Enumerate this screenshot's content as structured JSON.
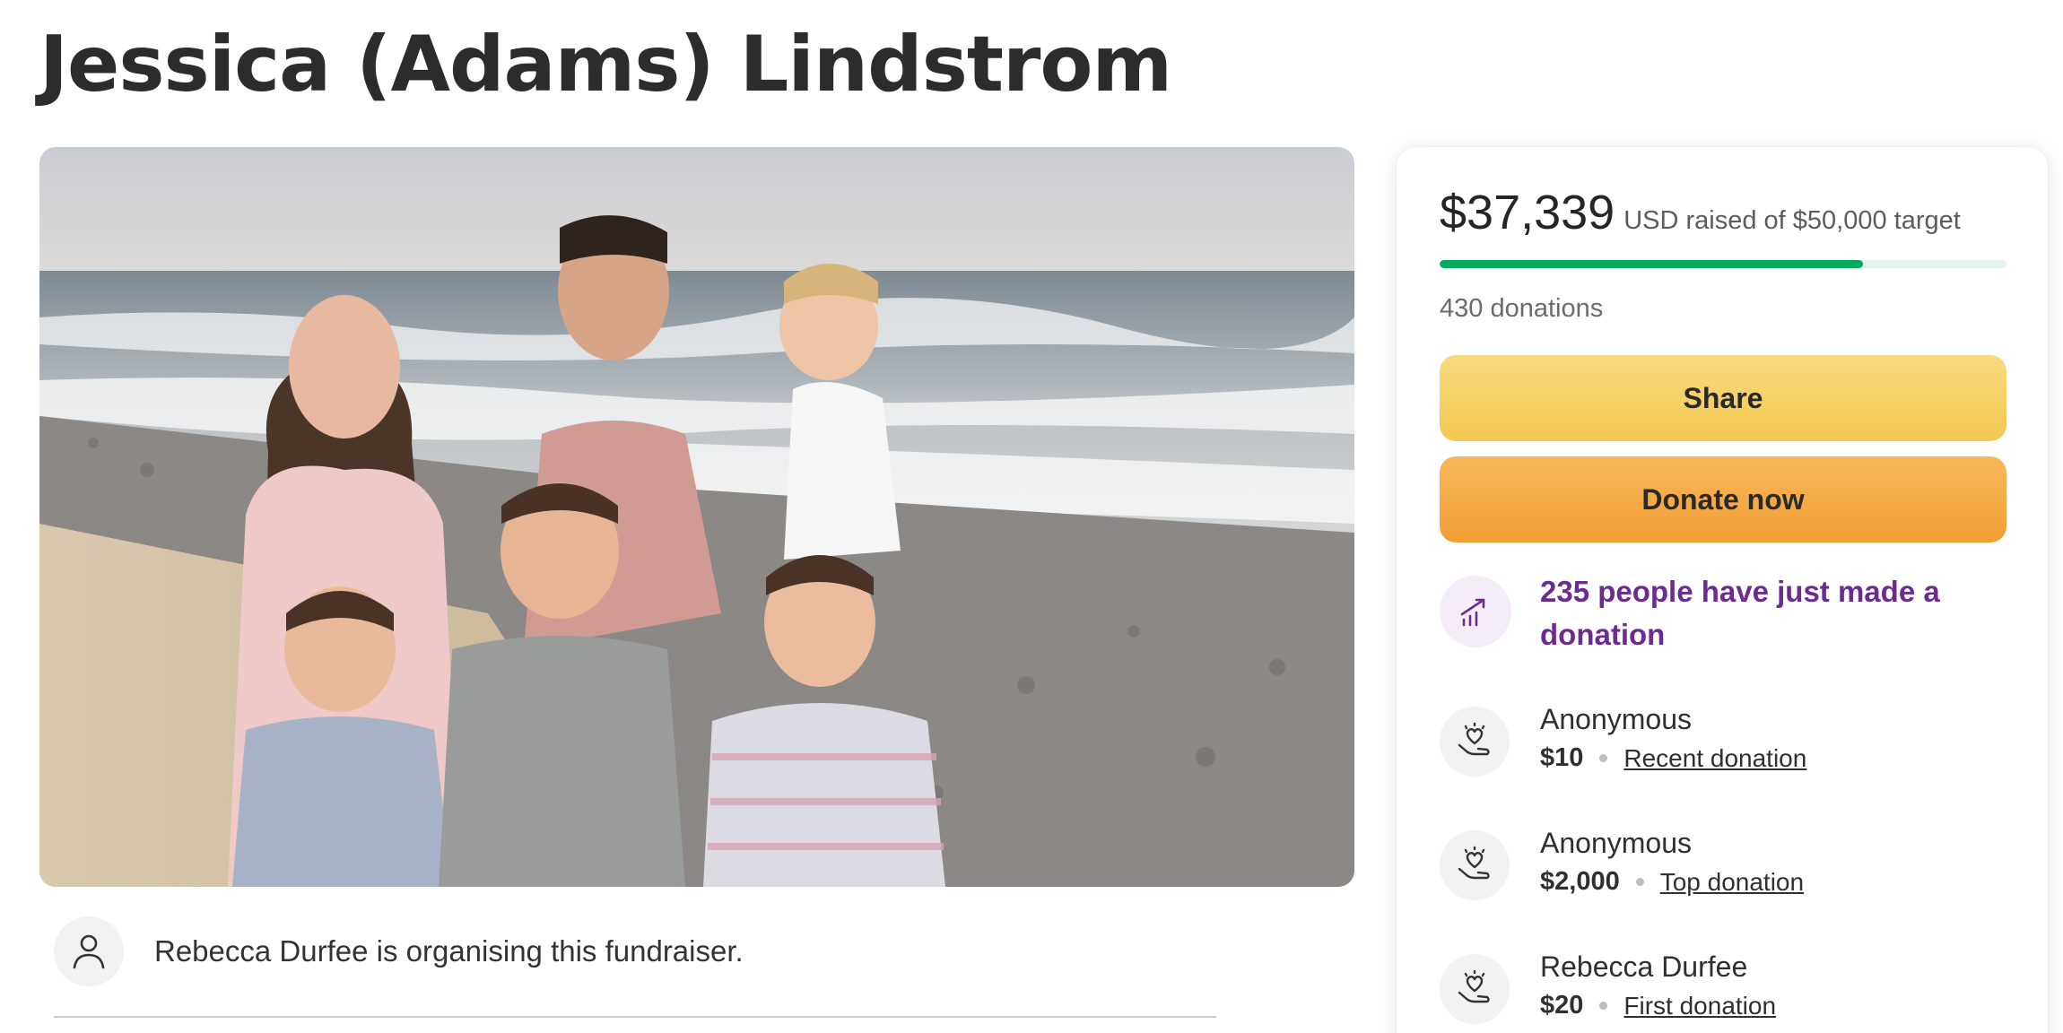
{
  "page": {
    "title": "Jessica (Adams) Lindstrom"
  },
  "hero": {
    "alt": "Family photo on the beach"
  },
  "organiser": {
    "text": "Rebecca Durfee is organising this fundraiser.",
    "icon": "person-icon"
  },
  "donation_panel": {
    "raised_amount": "$37,339",
    "raised_suffix": "USD raised of $50,000 target",
    "progress_fraction": 0.7468,
    "donations_count": "430 donations",
    "share_label": "Share",
    "donate_label": "Donate now",
    "trend_text": "235 people have just made a donation",
    "trend_icon": "trending-chart-icon",
    "donors": [
      {
        "name": "Anonymous",
        "amount": "$10",
        "tag": "Recent donation",
        "icon": "heart-hand-icon"
      },
      {
        "name": "Anonymous",
        "amount": "$2,000",
        "tag": "Top donation",
        "icon": "heart-hand-icon"
      },
      {
        "name": "Rebecca Durfee",
        "amount": "$20",
        "tag": "First donation",
        "icon": "heart-hand-icon"
      }
    ],
    "colors": {
      "progress": "#02a95c",
      "progress_track": "#e4f3ec",
      "share_button": "#f3c752",
      "donate_button": "#f19f35",
      "trend_text": "#6c2b8e"
    }
  }
}
